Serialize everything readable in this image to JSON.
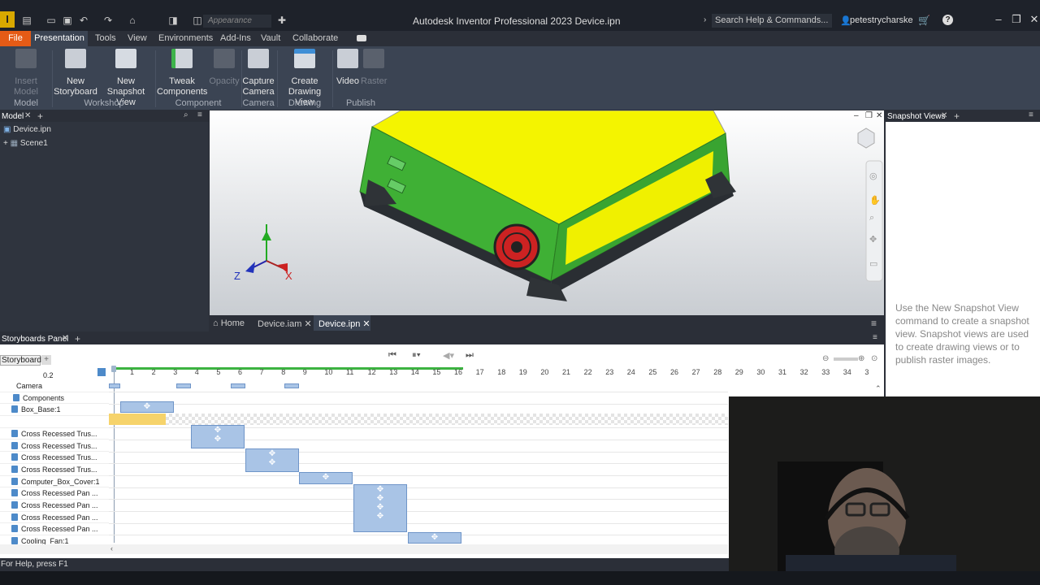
{
  "app": {
    "title": "Autodesk Inventor Professional 2023   Device.ipn",
    "logo": "I"
  },
  "quick_access": {
    "appearance_placeholder": "Appearance"
  },
  "search": {
    "label": "Search Help & Commands..."
  },
  "user": {
    "name": "petestrycharske"
  },
  "menu": {
    "file": "File",
    "tabs": [
      "Presentation",
      "Tools",
      "View",
      "Environments",
      "Add-Ins",
      "Vault",
      "Collaborate"
    ]
  },
  "ribbon": {
    "insert_model": "Insert Model",
    "new_storyboard": [
      "New",
      "Storyboard"
    ],
    "new_snapshot": [
      "New",
      "Snapshot View"
    ],
    "tweak": [
      "Tweak",
      "Components"
    ],
    "opacity": "Opacity",
    "capture_camera": [
      "Capture",
      "Camera"
    ],
    "create_drawing": [
      "Create",
      "Drawing View"
    ],
    "video": "Video",
    "raster": "Raster",
    "groups": [
      "Model",
      "Workshop",
      "Component",
      "Camera",
      "Drawing",
      "Publish"
    ]
  },
  "model_panel": {
    "title": "Model",
    "items": [
      "Device.ipn",
      "Scene1"
    ]
  },
  "doc_tabs": {
    "home": "Home",
    "tab1": "Device.iam",
    "tab2": "Device.ipn"
  },
  "snapshot_panel": {
    "title": "Snapshot Views",
    "message": "Use the New Snapshot View command to create a snapshot view. Snapshot views are used to create drawing views or to publish raster images."
  },
  "storyboard": {
    "panel_title": "Storyboards Panel",
    "tab": "Storyboard1",
    "time": "0.2",
    "ticks": [
      "1",
      "2",
      "3",
      "4",
      "5",
      "6",
      "7",
      "8",
      "9",
      "10",
      "11",
      "12",
      "13",
      "14",
      "15",
      "16",
      "17",
      "18",
      "19",
      "20",
      "21",
      "22",
      "23",
      "24",
      "25",
      "26",
      "27",
      "28",
      "29",
      "30",
      "31",
      "32",
      "33",
      "34",
      "3"
    ],
    "rows": [
      "Camera",
      "Components",
      "Box_Base:1",
      "",
      "Cross Recessed Trus...",
      "Cross Recessed Trus...",
      "Cross Recessed Trus...",
      "Cross Recessed Trus...",
      "Computer_Box_Cover:1",
      "Cross Recessed Pan ...",
      "Cross Recessed Pan ...",
      "Cross Recessed Pan ...",
      "Cross Recessed Pan ...",
      "Cooling_Fan:1"
    ]
  },
  "status": {
    "text": "For Help, press F1"
  },
  "axes": {
    "x": "X",
    "z": "Z"
  }
}
